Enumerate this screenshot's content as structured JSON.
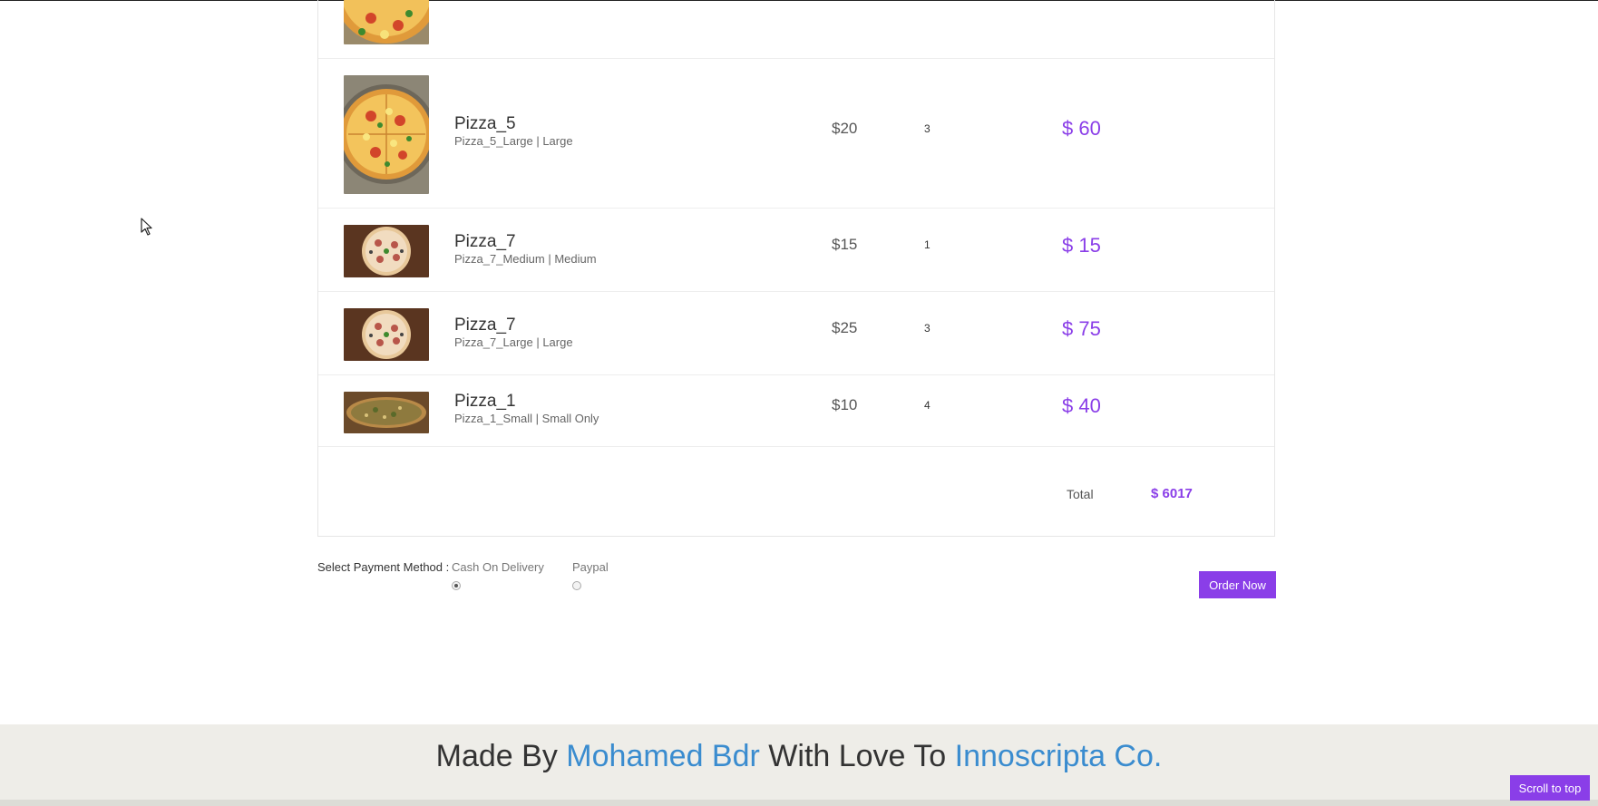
{
  "cart": {
    "items": [
      {
        "name": "",
        "variant": "",
        "price": "",
        "qty": "",
        "subtotal": ""
      },
      {
        "name": "Pizza_5",
        "variant": "Pizza_5_Large | Large",
        "price": "$20",
        "qty": "3",
        "subtotal": "$ 60"
      },
      {
        "name": "Pizza_7",
        "variant": "Pizza_7_Medium | Medium",
        "price": "$15",
        "qty": "1",
        "subtotal": "$ 15"
      },
      {
        "name": "Pizza_7",
        "variant": "Pizza_7_Large | Large",
        "price": "$25",
        "qty": "3",
        "subtotal": "$ 75"
      },
      {
        "name": "Pizza_1",
        "variant": "Pizza_1_Small | Small Only",
        "price": "$10",
        "qty": "4",
        "subtotal": "$ 40"
      }
    ],
    "total_label": "Total",
    "total_value": "$ 6017"
  },
  "payment": {
    "label": "Select Payment Method :",
    "options": [
      {
        "label": "Cash On Delivery",
        "selected": true
      },
      {
        "label": "Paypal",
        "selected": false
      }
    ],
    "order_button": "Order Now"
  },
  "footer": {
    "prefix": "Made By",
    "author": "Mohamed Bdr",
    "middle": "With Love To",
    "company": "Innoscripta Co."
  },
  "scroll_to_top": "Scroll to top",
  "colors": {
    "accent": "#8a3ee8",
    "link": "#3a8ccf",
    "footer_bg": "#eeede8"
  },
  "icons": {
    "cursor": "mouse-pointer-icon",
    "radio": "radio-icon"
  }
}
